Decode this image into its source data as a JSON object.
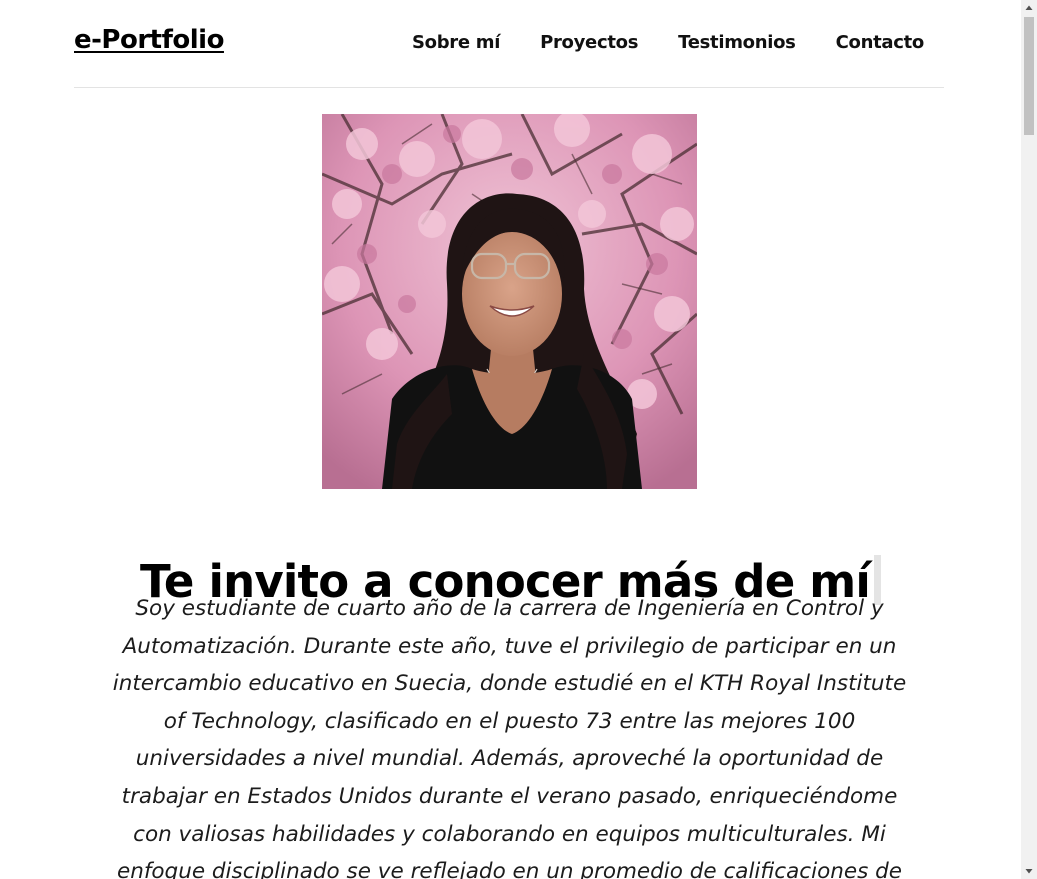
{
  "header": {
    "brand": "e-Portfolio",
    "nav": [
      {
        "label": "Sobre mí"
      },
      {
        "label": "Proyectos"
      },
      {
        "label": "Testimonios"
      },
      {
        "label": "Contacto"
      }
    ]
  },
  "hero": {
    "headline": "Te invito a conocer más de mí",
    "bio": "Soy estudiante de cuarto año de la carrera de Ingeniería en Control y Automatización. Durante este año, tuve el privilegio de participar en un intercambio educativo en Suecia, donde estudié en el KTH Royal Institute of Technology, clasificado en el puesto 73 entre las mejores 100 universidades a nivel mundial. Además, aproveché la oportunidad de trabajar en Estados Unidos durante el verano pasado, enriqueciéndome con valiosas habilidades y colaborando en equipos multiculturales. Mi enfoque disciplinado se ve reflejado en un promedio de calificaciones de"
  },
  "colors": {
    "blossom": "#d98cb0",
    "blossom_light": "#eab4cc",
    "branch": "#4a2e33",
    "shirt": "#111111",
    "hair": "#1f1414",
    "skin": "#c98f74"
  },
  "icons": {
    "scroll_up": "triangle-up-icon",
    "scroll_down": "triangle-down-icon"
  }
}
